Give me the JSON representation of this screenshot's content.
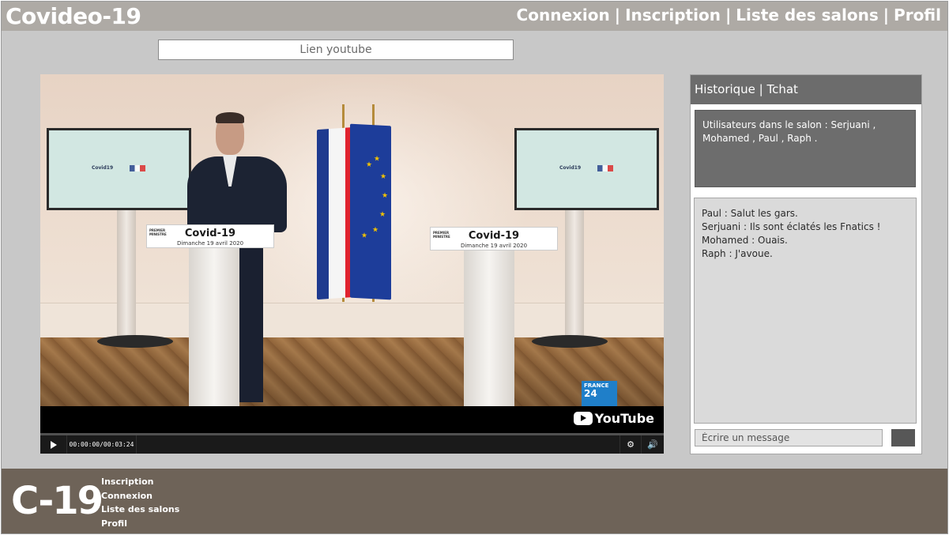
{
  "header": {
    "brand": "Covideo-19",
    "nav": {
      "login": "Connexion",
      "signup": "Inscription",
      "rooms": "Liste des salons",
      "profile": "Profil",
      "separator": "|"
    }
  },
  "youtube_link": {
    "placeholder": "Lien youtube",
    "value": ""
  },
  "video": {
    "sign_title": "Covid-19",
    "sign_subtitle": "Dimanche 19 avril 2020",
    "sign_org": "PREMIER MINISTRE",
    "screen_text": "Covid19",
    "channel_badge_line1": "FRANCE",
    "channel_badge_line2": "24",
    "platform_logo_text": "YouTube",
    "time_display": "00:00:00/00:03:24",
    "progress": 0
  },
  "chat": {
    "header": "Historique | Tchat",
    "users_text": "Utilisateurs dans le salon : Serjuani , Mohamed , Paul , Raph .",
    "messages": [
      "Paul : Salut les gars.",
      "Serjuani : Ils sont éclatés les Fnatics !",
      "Mohamed : Ouais.",
      "Raph : J'avoue."
    ],
    "input_placeholder": "Écrire un message",
    "input_value": ""
  },
  "footer": {
    "logo": "C-19",
    "links": {
      "signup": "Inscription",
      "login": "Connexion",
      "rooms": "Liste des salons",
      "profile": "Profil"
    }
  },
  "colors": {
    "header_bg": "#aeaaa5",
    "page_bg": "#c8c8c8",
    "footer_bg": "#6e6358",
    "chat_header_bg": "#6c6c6c",
    "users_box_bg": "#6d6d6d",
    "messages_bg": "#dadada",
    "send_button": "#575757"
  }
}
